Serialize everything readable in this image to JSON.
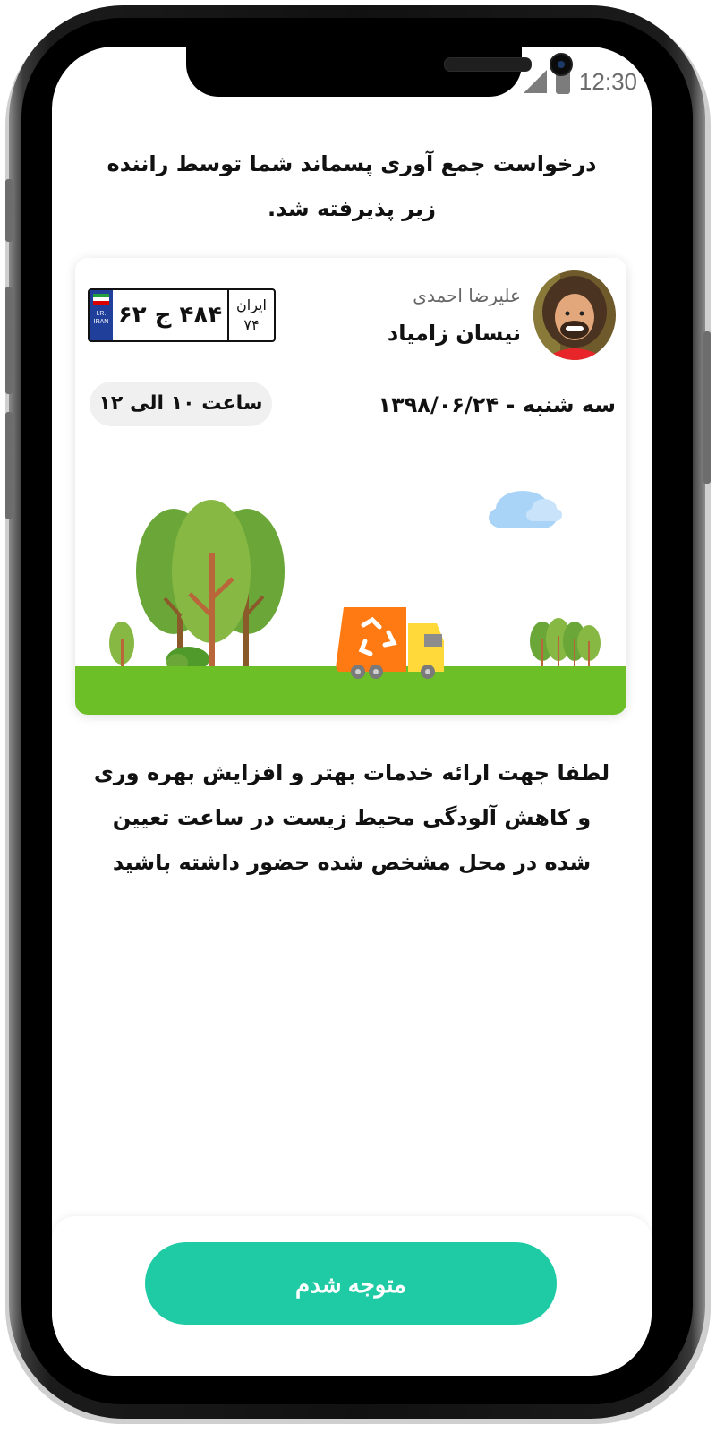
{
  "status_bar": {
    "time": "12:30",
    "signal_icon": "signal-icon",
    "battery_icon": "battery-icon"
  },
  "header": {
    "message": "درخواست جمع آوری پسماند شما توسط راننده زیر پذیرفته شد."
  },
  "driver": {
    "name": "علیرضا احمدی",
    "vehicle": "نیسان زامیاد",
    "pickup_date": "سه شنبه - ۱۳۹۸/۰۶/۲۴",
    "time_slot": "ساعت ۱۰ الی ۱۲",
    "plate": {
      "number": "۴۸۴ ج ۶۲",
      "region_label": "ایران",
      "region_code": "۷۴",
      "country_top": "I.R.",
      "country_bottom": "IRAN"
    }
  },
  "body": {
    "message": "لطفا جهت ارائه خدمات بهتر و افزایش بهره وری و کاهش آلودگی محیط زیست در ساعت تعیین شده در محل مشخص شده حضور داشته باشید"
  },
  "actions": {
    "confirm_label": "متوجه شدم"
  },
  "colors": {
    "accent": "#1fcba4",
    "grass": "#6cbf26",
    "truck": "#ff7a12",
    "truck_cab": "#ffd83a"
  }
}
